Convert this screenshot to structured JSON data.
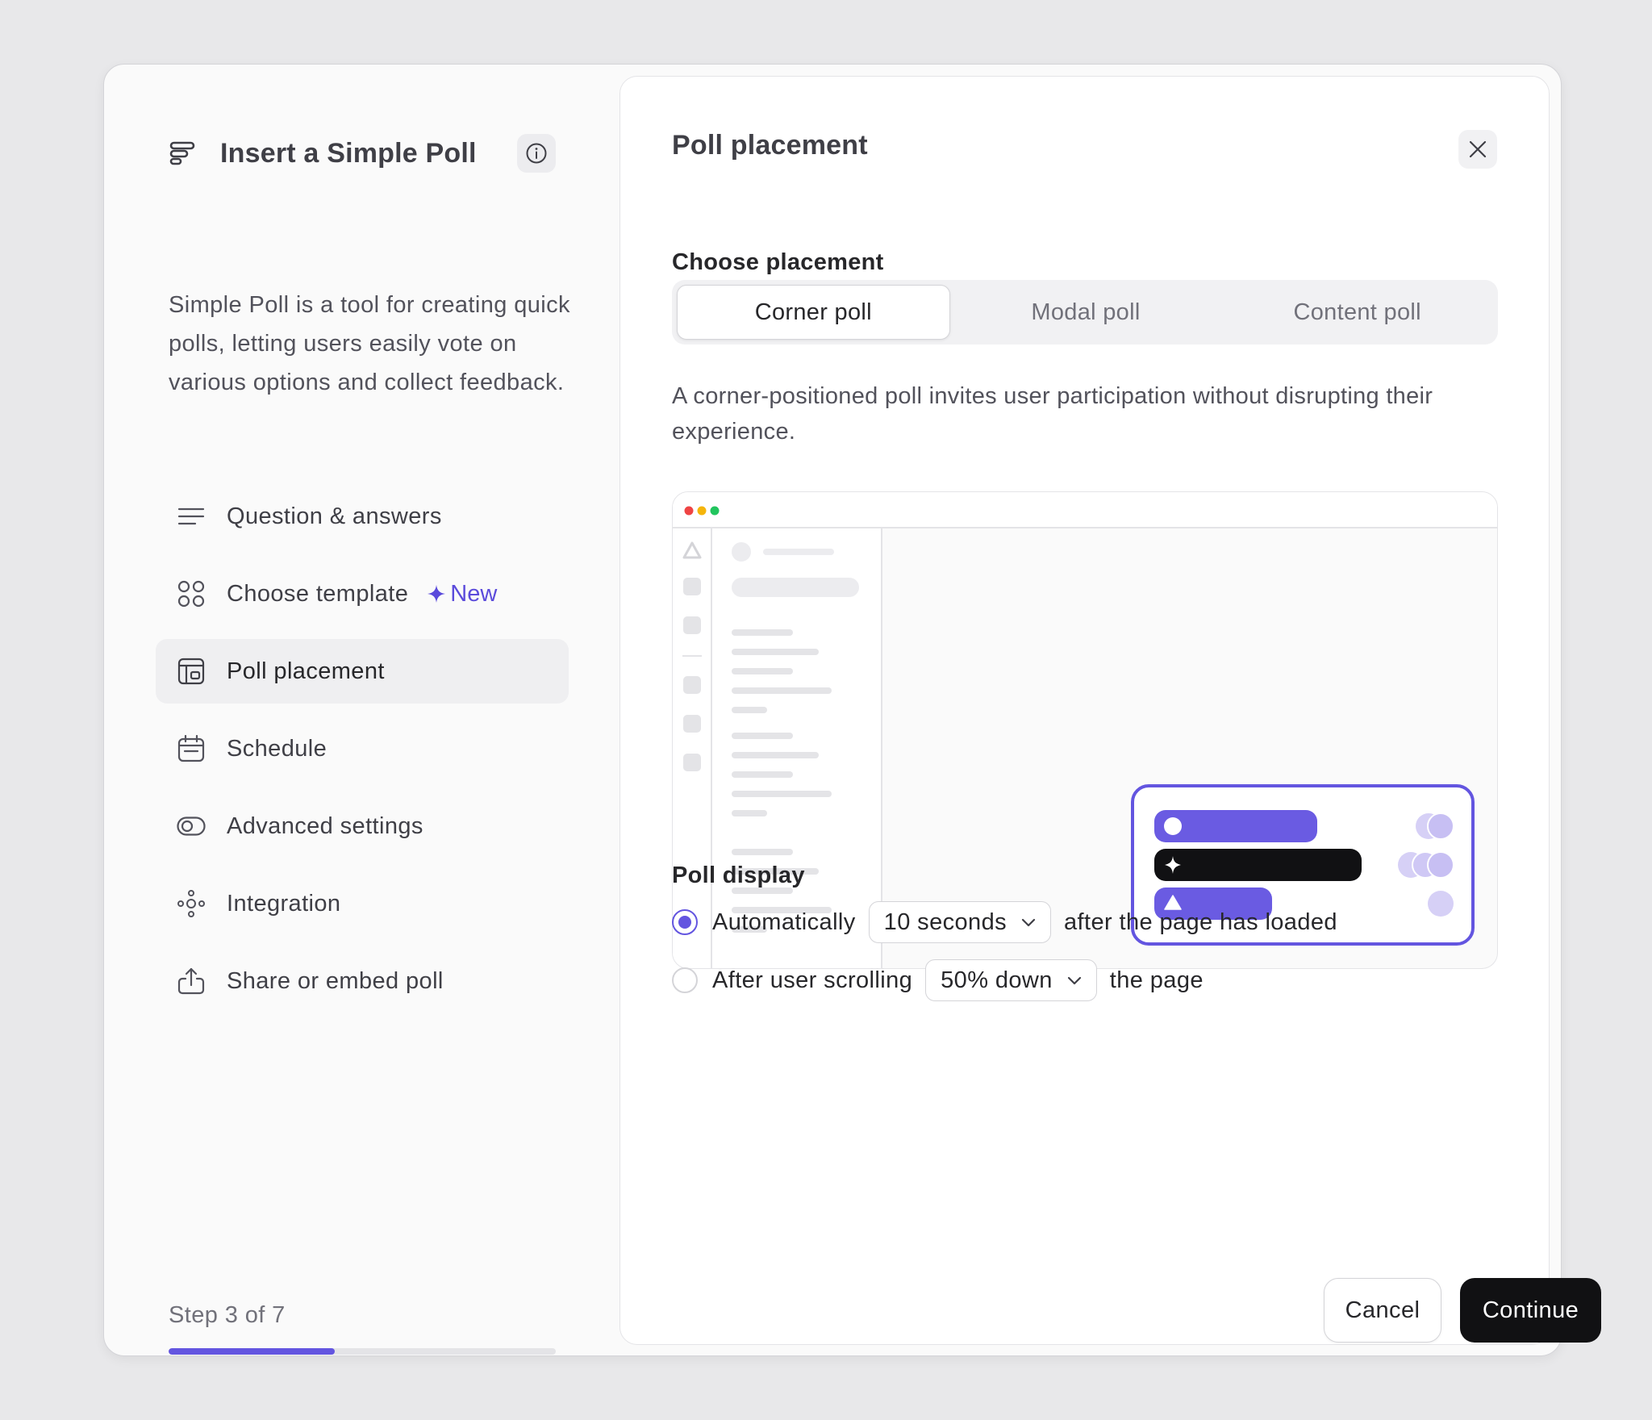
{
  "sidebar": {
    "title": "Insert a Simple Poll",
    "description": "Simple Poll is a tool for creating quick polls, letting users easily vote on various options and collect feedback.",
    "items": [
      {
        "label": "Question & answers",
        "icon": "text-lines-icon"
      },
      {
        "label": "Choose template",
        "icon": "grid-circles-icon",
        "badge": "New"
      },
      {
        "label": "Poll placement",
        "icon": "layout-icon",
        "active": true
      },
      {
        "label": "Schedule",
        "icon": "calendar-icon"
      },
      {
        "label": "Advanced settings",
        "icon": "toggle-icon"
      },
      {
        "label": "Integration",
        "icon": "nodes-icon"
      },
      {
        "label": "Share or embed poll",
        "icon": "share-icon"
      }
    ],
    "step_label": "Step 3 of 7",
    "progress": 0.4286
  },
  "panel": {
    "title": "Poll placement",
    "choose_label": "Choose placement",
    "tabs": [
      {
        "label": "Corner poll",
        "active": true
      },
      {
        "label": "Modal poll"
      },
      {
        "label": "Content poll"
      }
    ],
    "description": "A corner-positioned poll invites user participation without disrupting their experience.",
    "display_label": "Poll display",
    "options": {
      "auto": {
        "label": "Automatically",
        "select": "10 seconds",
        "suffix": "after the page has loaded",
        "checked": true
      },
      "scroll": {
        "label": "After user scrolling",
        "select": "50% down",
        "suffix": "the page",
        "checked": false
      }
    },
    "cancel_label": "Cancel",
    "continue_label": "Continue"
  },
  "colors": {
    "accent": "#6355e0",
    "primary_button": "#111113",
    "traffic_red": "#ef4444",
    "traffic_yellow": "#f5b50b",
    "traffic_green": "#22c55e"
  }
}
